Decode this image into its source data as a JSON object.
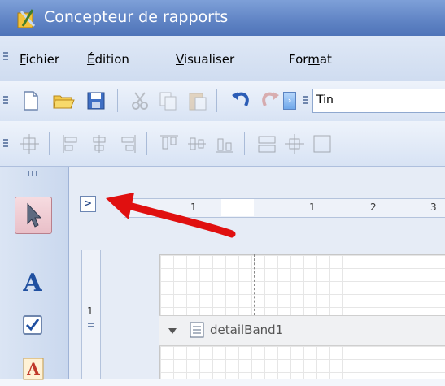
{
  "window": {
    "title": "Concepteur de rapports"
  },
  "menu": [
    {
      "pre": "",
      "ul": "F",
      "post": "ichier"
    },
    {
      "pre": "",
      "ul": "É",
      "post": "dition"
    },
    {
      "pre": "",
      "ul": "V",
      "post": "isualiser"
    },
    {
      "pre": "For",
      "ul": "m",
      "post": "at"
    }
  ],
  "toolbar": {
    "font_value": "Tin"
  },
  "ruler": {
    "h_labels": [
      "1",
      "1",
      "2",
      "3"
    ],
    "v_labels": [
      "1"
    ]
  },
  "band": {
    "label": "detailBand1"
  },
  "colors": {
    "arrow": "#e01010",
    "titlebar": "#5f83c4"
  }
}
